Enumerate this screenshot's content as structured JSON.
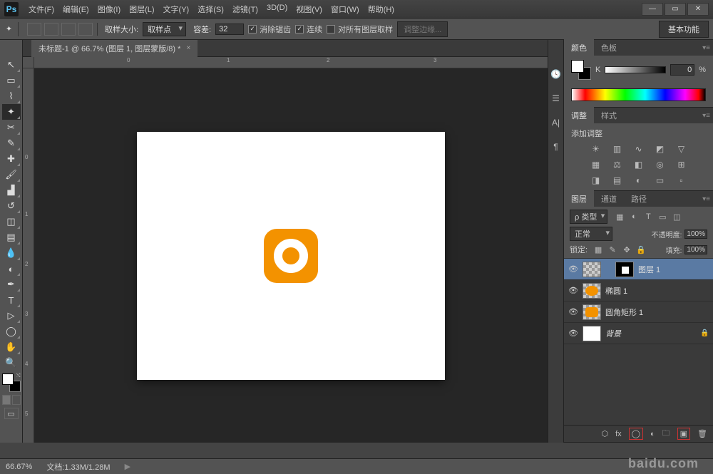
{
  "titlebar": {
    "logo": "Ps"
  },
  "menu": [
    "文件(F)",
    "编辑(E)",
    "图像(I)",
    "图层(L)",
    "文字(Y)",
    "选择(S)",
    "滤镜(T)",
    "3D(D)",
    "视图(V)",
    "窗口(W)",
    "帮助(H)"
  ],
  "options": {
    "sample_size_label": "取样大小:",
    "sample_size_value": "取样点",
    "tolerance_label": "容差:",
    "tolerance_value": "32",
    "antialias": "消除锯齿",
    "contiguous": "连续",
    "all_layers": "对所有图层取样",
    "refine": "调整边缘...",
    "workspace_btn": "基本功能"
  },
  "document": {
    "tab": "未标题-1 @ 66.7% (图层 1, 图层蒙版/8) *"
  },
  "panels": {
    "color": {
      "tab1": "颜色",
      "tab2": "色板",
      "k_label": "K",
      "k_value": "0",
      "k_unit": "%"
    },
    "adjust": {
      "tab1": "调整",
      "tab2": "样式",
      "title": "添加调整"
    },
    "layers": {
      "tab1": "图层",
      "tab2": "通道",
      "tab3": "路径",
      "kind": "类型",
      "blend": "正常",
      "opacity_label": "不透明度:",
      "opacity_value": "100%",
      "lock_label": "锁定:",
      "fill_label": "填充:",
      "fill_value": "100%",
      "items": [
        {
          "name": "图层 1"
        },
        {
          "name": "椭圆 1"
        },
        {
          "name": "圆角矩形 1"
        },
        {
          "name": "背景"
        }
      ]
    }
  },
  "status": {
    "zoom": "66.67%",
    "doc": "文档:1.33M/1.28M"
  },
  "watermark": "baidu.com"
}
